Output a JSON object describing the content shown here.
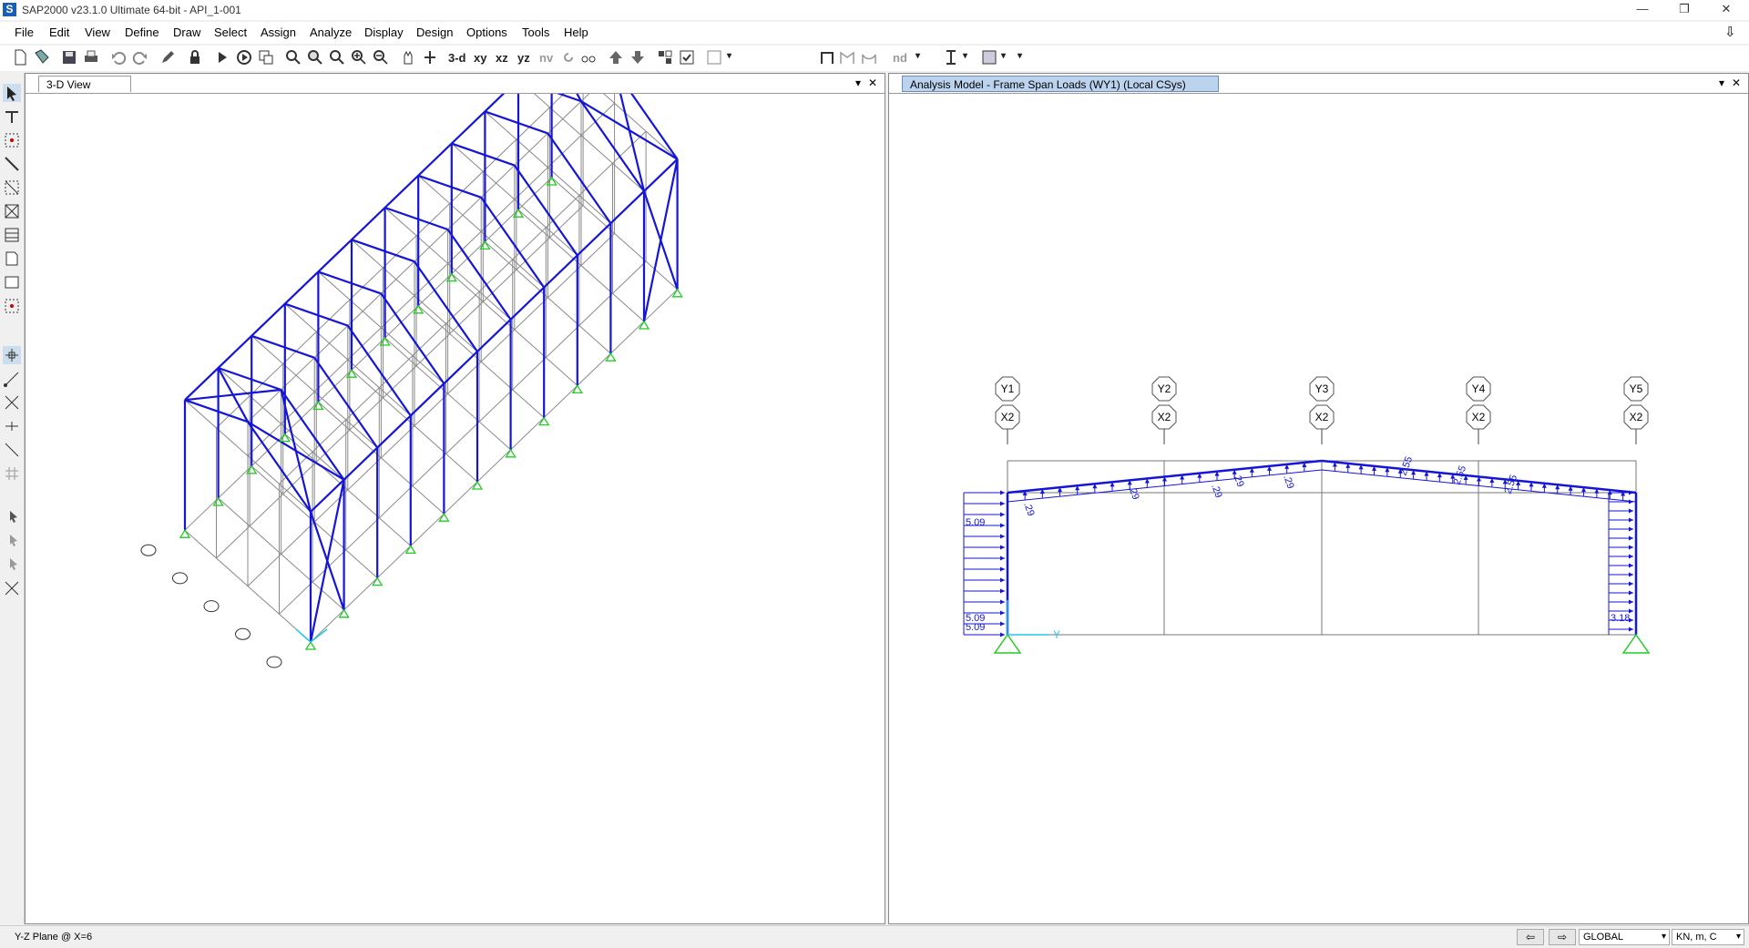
{
  "app": {
    "title": "SAP2000 v23.1.0 Ultimate 64-bit - API_1-001",
    "logo": "S"
  },
  "window_controls": {
    "minimize": "—",
    "restore": "❐",
    "close": "✕",
    "download": "⇩"
  },
  "menu": [
    "File",
    "Edit",
    "View",
    "Define",
    "Draw",
    "Select",
    "Assign",
    "Analyze",
    "Display",
    "Design",
    "Options",
    "Tools",
    "Help"
  ],
  "toolbar": {
    "view_3d": "3-d",
    "view_xy": "xy",
    "view_xz": "xz",
    "view_yz": "yz",
    "view_nv": "nv",
    "view_nd": "nd"
  },
  "panes": {
    "left": {
      "tab": "3-D View"
    },
    "right": {
      "tab": "Analysis Model - Frame Span Loads (WY1) (Local CSys)"
    },
    "dropdown_glyph": "▾",
    "close_glyph": "✕"
  },
  "grid_bubbles": {
    "top": [
      "Y1",
      "Y2",
      "Y3",
      "Y4",
      "Y5"
    ],
    "bottom": [
      "X2",
      "X2",
      "X2",
      "X2",
      "X2"
    ]
  },
  "load_labels": {
    "left_top": "5.09",
    "left_bottom1": "5.09",
    "left_bottom2": "5.09",
    "right_bottom": "3.18",
    "rafter_neg": ".29",
    "rafter_pos": "2.55"
  },
  "axis_label": "Y",
  "status": {
    "plane": "Y-Z Plane @ X=6",
    "coord_system": "GLOBAL",
    "units": "KN, m, C",
    "nav_prev": "⇦",
    "nav_next": "⇨"
  },
  "colors": {
    "frame": "#1515d8",
    "grid_line": "#8a8a8a",
    "support": "#22cc22",
    "axis": "#22c8e6",
    "tab_active": "#bcd3ee"
  }
}
